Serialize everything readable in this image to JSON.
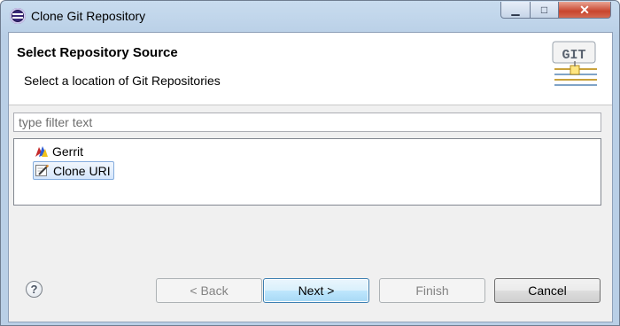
{
  "window": {
    "title": "Clone Git Repository"
  },
  "window_controls": {
    "minimize": "▁",
    "maximize": "□",
    "close": "✕"
  },
  "header": {
    "title": "Select Repository Source",
    "description": "Select a location of Git Repositories",
    "logo_text": "GIT"
  },
  "filter": {
    "placeholder": "type filter text",
    "value": ""
  },
  "sources": [
    {
      "label": "Gerrit",
      "icon": "gerrit-icon",
      "selected": false
    },
    {
      "label": "Clone URI",
      "icon": "clone-uri-icon",
      "selected": true
    }
  ],
  "buttons": {
    "help": "?",
    "back": "< Back",
    "next": "Next >",
    "finish": "Finish",
    "cancel": "Cancel"
  },
  "colors": {
    "window_frame": "#b9cfe6",
    "selection": "#d5e6fb",
    "default_button": "#bee6fd",
    "close_button": "#c8452e"
  }
}
